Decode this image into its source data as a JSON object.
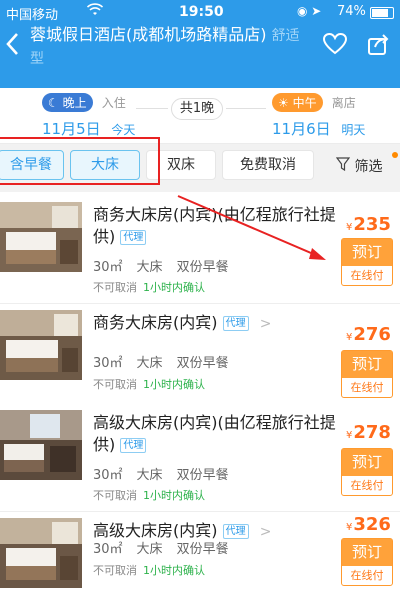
{
  "status_bar": {
    "carrier": "中国移动",
    "time": "19:50",
    "battery": "74%"
  },
  "header": {
    "hotel_name": "蓉城假日酒店(成都机场路精品店)",
    "hotel_tag": "舒适型"
  },
  "dates": {
    "checkin": {
      "badge": "晚上",
      "label": "入住",
      "date": "11月5日",
      "day": "今天"
    },
    "nights": "共1晚",
    "checkout": {
      "badge": "中午",
      "label": "离店",
      "date": "11月6日",
      "day": "明天"
    }
  },
  "filters": {
    "chips": [
      "含早餐",
      "大床",
      "双床",
      "免费取消"
    ],
    "active": [
      "含早餐",
      "大床"
    ],
    "filter_label": "筛选"
  },
  "rooms": [
    {
      "name": "商务大床房(内宾)(由亿程旅行社提供)",
      "agent": "代理",
      "area": "30㎡",
      "bed": "大床",
      "breakfast": "双份早餐",
      "cancel": "不可取消",
      "confirm": "1小时内确认",
      "currency": "¥",
      "price": "235",
      "book": "预订",
      "pay": "在线付"
    },
    {
      "name": "商务大床房(内宾)",
      "agent": "代理",
      "area": "30㎡",
      "bed": "大床",
      "breakfast": "双份早餐",
      "cancel": "不可取消",
      "confirm": "1小时内确认",
      "currency": "¥",
      "price": "276",
      "book": "预订",
      "pay": "在线付"
    },
    {
      "name": "高级大床房(内宾)(由亿程旅行社提供)",
      "agent": "代理",
      "area": "30㎡",
      "bed": "大床",
      "breakfast": "双份早餐",
      "cancel": "不可取消",
      "confirm": "1小时内确认",
      "currency": "¥",
      "price": "278",
      "book": "预订",
      "pay": "在线付"
    },
    {
      "name": "高级大床房(内宾)",
      "agent": "代理",
      "area": "30㎡",
      "bed": "大床",
      "breakfast": "双份早餐",
      "cancel": "不可取消",
      "confirm": "1小时内确认",
      "currency": "¥",
      "price": "326",
      "book": "预订",
      "pay": "在线付"
    }
  ],
  "colors": {
    "brand": "#2d9be9",
    "price": "#ff6a1a",
    "book_button": "#ffa23a",
    "confirm_green": "#2db24b",
    "annotation_red": "#e82222"
  }
}
